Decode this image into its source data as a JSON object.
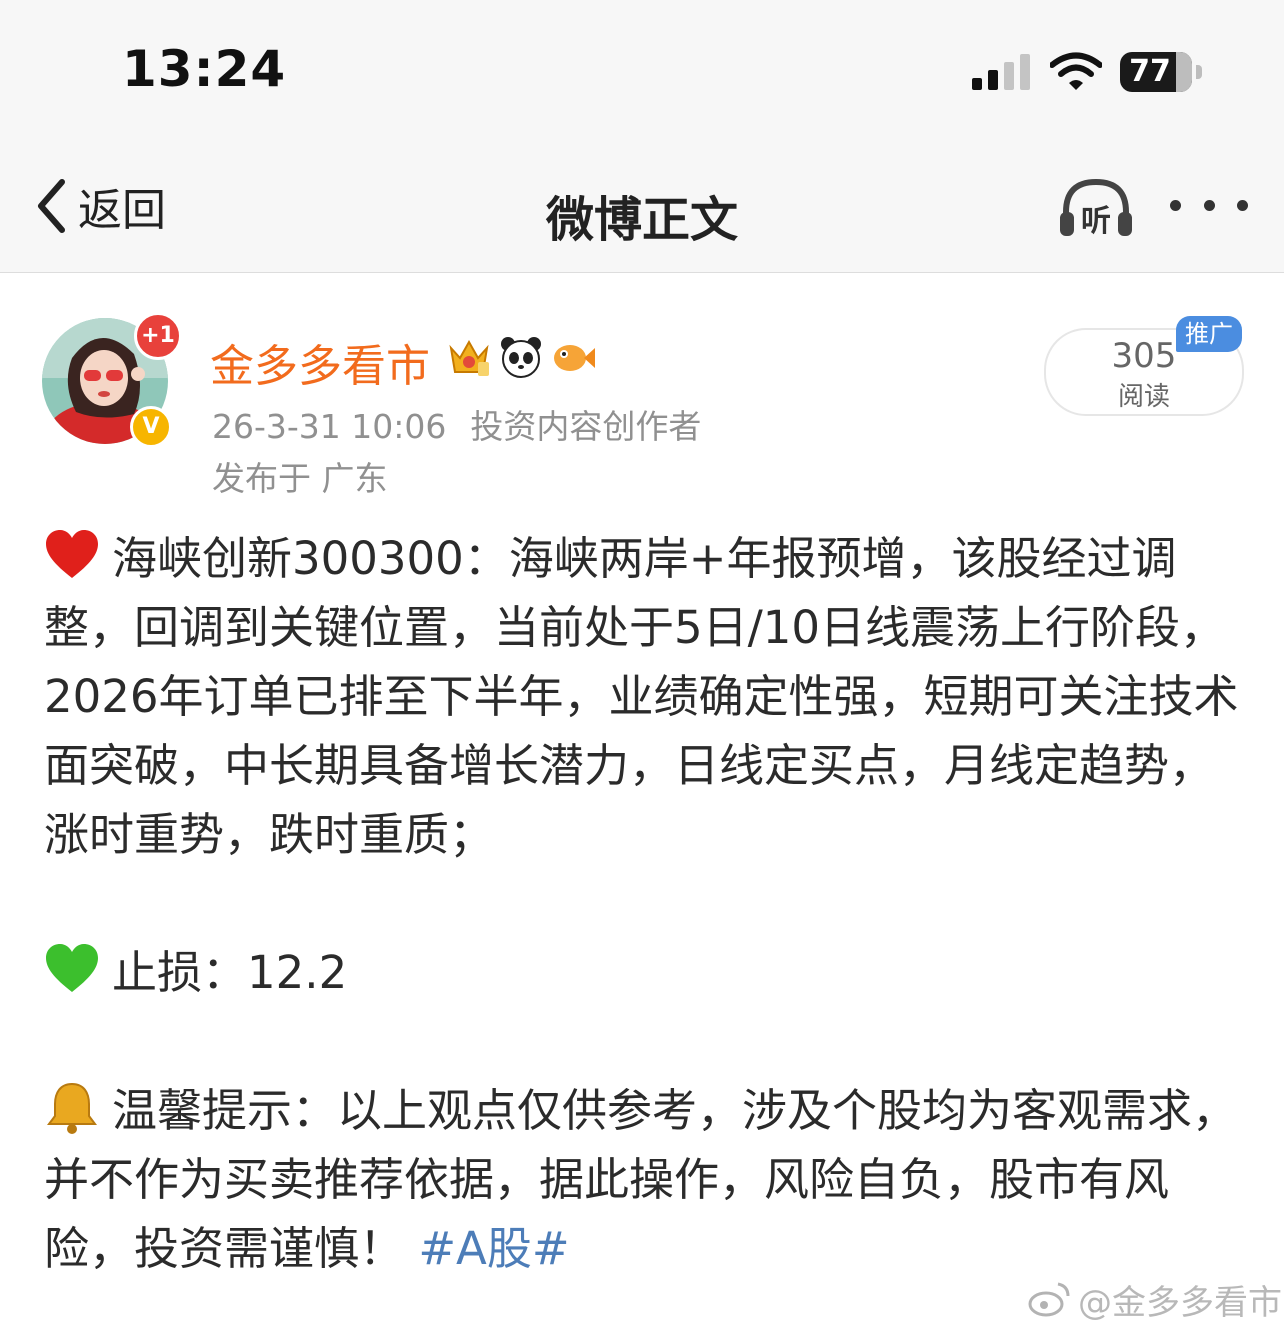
{
  "status_bar": {
    "time": "13:24",
    "battery": "77",
    "icons": [
      "signal-icon",
      "wifi-icon",
      "battery-icon"
    ]
  },
  "nav": {
    "back_label": "返回",
    "title": "微博正文",
    "listen_label": "听",
    "icons": [
      "chevron-left-icon",
      "headphones-icon",
      "more-icon"
    ]
  },
  "author": {
    "name": "金多多看市",
    "plus_badge": "+1",
    "verified_mark": "V",
    "emblems": [
      "crown-badge-icon",
      "panda-badge-icon",
      "fish-badge-icon"
    ],
    "timestamp": "26-3-31 10:06",
    "role": "投资内容创作者",
    "location": "发布于 广东"
  },
  "stats": {
    "read_count": "305",
    "read_label": "阅读",
    "promo_tag": "推广"
  },
  "post": {
    "paragraph1": "海峡创新300300：海峡两岸+年报预增，该股经过调整，回调到关键位置，当前处于5日/10日线震荡上行阶段，2026年订单已排至下半年，业绩确定性强，短期可关注技术面突破，中长期具备增长潜力，日线定买点，月线定趋势，涨时重势，跌时重质；",
    "paragraph2": "止损：12.2",
    "paragraph3": "温馨提示：以上观点仅供参考，涉及个股均为客观需求，并不作为买卖推荐依据，据此操作，风险自负，股市有风险，投资需谨慎！",
    "hashtag": "#A股#",
    "emoji_icons": [
      "red-heart-icon",
      "green-heart-icon",
      "bell-icon"
    ]
  },
  "watermark": "@金多多看市",
  "colors": {
    "author_name": "#f26b1d",
    "link": "#4d7db8",
    "promo_tag": "#4b8de0",
    "meta_text": "#909090"
  }
}
